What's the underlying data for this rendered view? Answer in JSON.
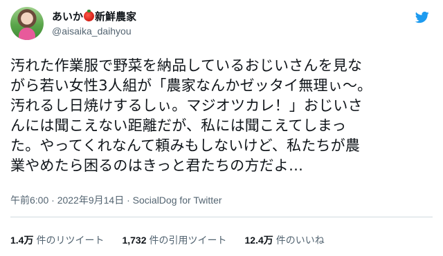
{
  "user": {
    "name_part1": "あいか",
    "name_icon": "tomato-icon",
    "name_part2": "新鮮農家",
    "handle": "@aisaika_daihyou"
  },
  "tweet": {
    "text": "汚れた作業服で野菜を納品しているおじいさんを見な\nがら若い女性3人組が「農家なんかゼッタイ無理ぃ〜。\n汚れるし日焼けするしぃ。マジオツカレ！」おじいさ\nんには聞こえない距離だが、私には聞こえてしまっ\nた。やってくれなんて頼みもしないけど、私たちが農\n業やめたら困るのはきっと君たちの方だよ…"
  },
  "meta": {
    "time": "午前6:00",
    "sep1": " · ",
    "date": "2022年9月14日",
    "sep2": " · ",
    "source": "SocialDog for Twitter"
  },
  "stats": [
    {
      "num": "1.4万",
      "label": "件のリツイート"
    },
    {
      "num": "1,732",
      "label": "件の引用ツイート"
    },
    {
      "num": "12.4万",
      "label": "件のいいね"
    }
  ],
  "colors": {
    "twitter_blue": "#1d9bf0",
    "secondary_text": "#536471"
  }
}
